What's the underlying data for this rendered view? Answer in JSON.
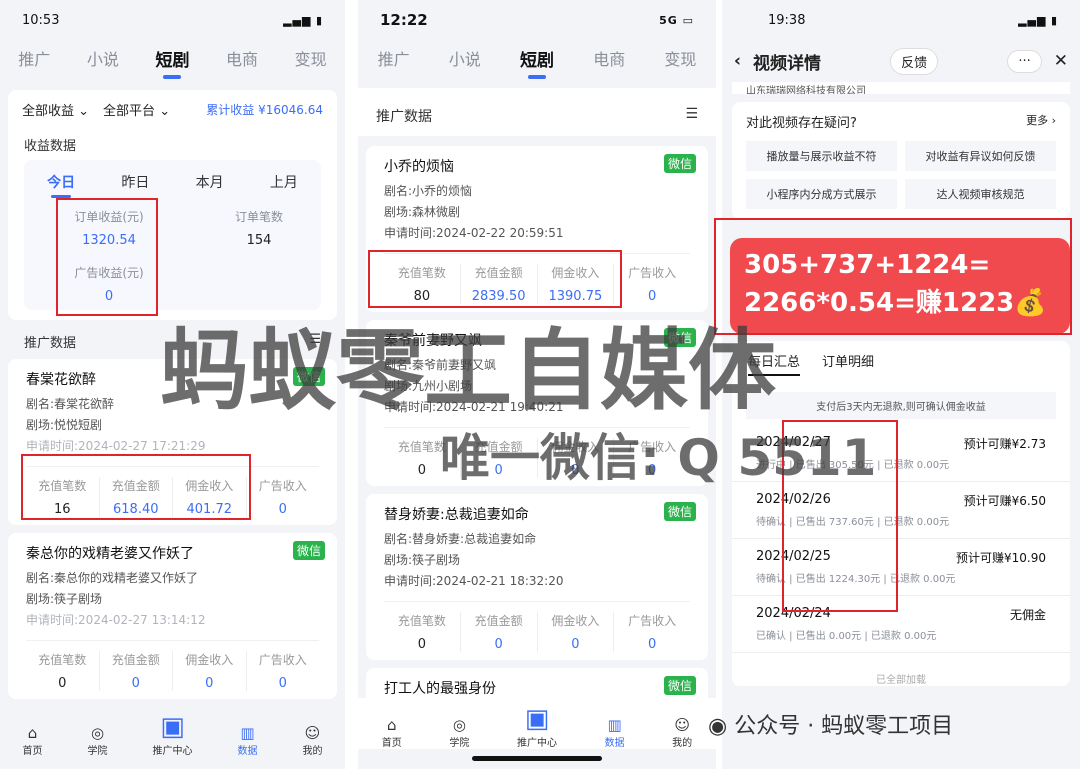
{
  "p1": {
    "time": "10:53",
    "tabs": [
      "推广",
      "小说",
      "短剧",
      "电商",
      "变现"
    ],
    "filter_income": "全部收益",
    "filter_platform": "全部平台",
    "total": "累计收益 ¥16046.64",
    "sec_income": "收益数据",
    "period_tabs": [
      "今日",
      "昨日",
      "本月",
      "上月"
    ],
    "order_income_label": "订单收益(元)",
    "order_income": "1320.54",
    "order_count_label": "订单笔数",
    "order_count": "154",
    "ad_income_label": "广告收益(元)",
    "ad_income": "0",
    "sec_promo": "推广数据",
    "dramas": [
      {
        "title": "春棠花欲醉",
        "name": "剧名:春棠花欲醉",
        "theater": "剧场:悦悦短剧",
        "time": "申请时间:2024-02-27 17:21:29",
        "vals": [
          "16",
          "618.40",
          "401.72",
          "0"
        ]
      },
      {
        "title": "秦总你的戏精老婆又作妖了",
        "name": "剧名:秦总你的戏精老婆又作妖了",
        "theater": "剧场:筷子剧场",
        "time": "申请时间:2024-02-27 13:14:12",
        "vals": [
          "0",
          "0",
          "0",
          "0"
        ]
      }
    ]
  },
  "stat_labels": [
    "充值笔数",
    "充值金额",
    "佣金收入",
    "广告收入"
  ],
  "wechat": "微信",
  "nav": [
    "首页",
    "学院",
    "推广中心",
    "数据",
    "我的"
  ],
  "p2": {
    "time": "12:22",
    "net": "5G",
    "sec": "推广数据",
    "dramas": [
      {
        "title": "小乔的烦恼",
        "name": "剧名:小乔的烦恼",
        "theater": "剧场:森林微剧",
        "time": "申请时间:2024-02-22 20:59:51",
        "vals": [
          "80",
          "2839.50",
          "1390.75",
          "0"
        ]
      },
      {
        "title": "秦爷前妻野又飒",
        "name": "剧名:秦爷前妻野又飒",
        "theater": "剧场:九州小剧场",
        "time": "申请时间:2024-02-21 19:40:21",
        "vals": [
          "0",
          "0",
          "0",
          "0"
        ]
      },
      {
        "title": "替身娇妻:总裁追妻如命",
        "name": "剧名:替身娇妻:总裁追妻如命",
        "theater": "剧场:筷子剧场",
        "time": "申请时间:2024-02-21 18:32:20",
        "vals": [
          "0",
          "0",
          "0",
          "0"
        ]
      },
      {
        "title": "打工人的最强身份"
      }
    ]
  },
  "p3": {
    "time": "19:38",
    "title": "视频详情",
    "feedback": "反馈",
    "more": "···",
    "company": "山东瑞瑞网络科技有限公司",
    "question": "对此视频存在疑问?",
    "more_link": "更多 ›",
    "btns": [
      "播放量与展示收益不符",
      "对收益有异议如何反馈",
      "小程序内分成方式展示",
      "达人视频审核规范"
    ],
    "banner1": "305+737+1224=",
    "banner2": "2266*0.54=赚1223💰",
    "tabs": [
      "每日汇总",
      "订单明细"
    ],
    "notice": "支付后3天内无退款,则可确认佣金收益",
    "days": [
      {
        "date": "2024/02/27",
        "est": "预计可赚¥2.73",
        "sub": "进行中 | 已售出 305.50元 | 已退款 0.00元"
      },
      {
        "date": "2024/02/26",
        "est": "预计可赚¥6.50",
        "sub": "待确认 | 已售出 737.60元 | 已退款 0.00元"
      },
      {
        "date": "2024/02/25",
        "est": "预计可赚¥10.90",
        "sub": "待确认 | 已售出 1224.30元 | 已退款 0.00元"
      },
      {
        "date": "2024/02/24",
        "est": "无佣金",
        "sub": "已确认 | 已售出 0.00元 | 已退款 0.00元"
      }
    ],
    "loaded": "已全部加载",
    "footer": "公众号 · 蚂蚁零工项目"
  },
  "watermark1": "蚂蚁零工自媒体",
  "watermark2": "唯一微信: Q 5511"
}
